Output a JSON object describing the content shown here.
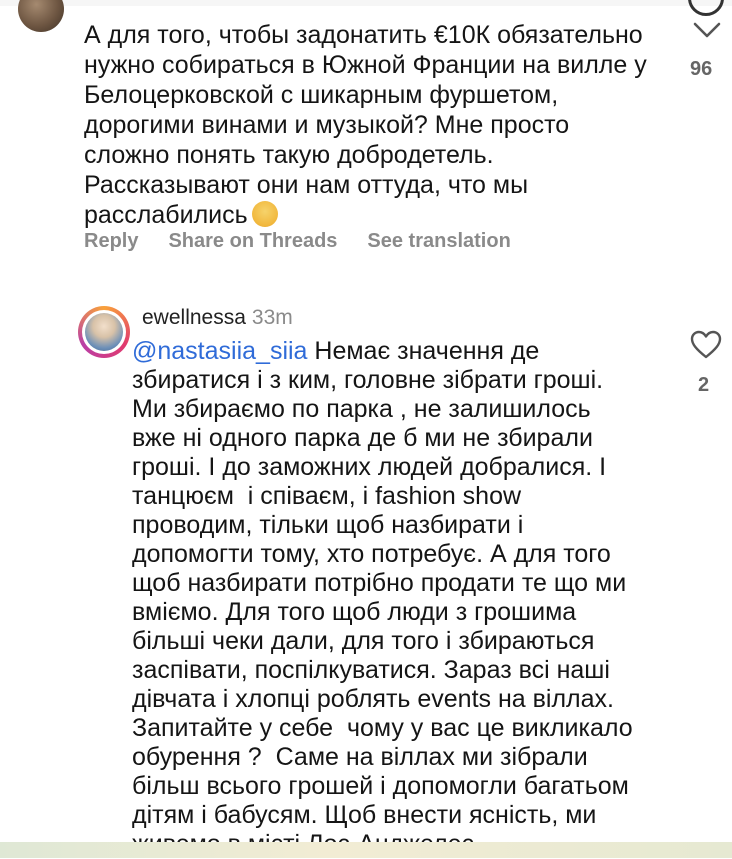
{
  "comment1": {
    "text_lines": [
      "А для того, чтобы задонатить €10К обязательно",
      "нужно собираться в Южной Франции на вилле у",
      "Белоцерковской с шикарным фуршетом,",
      "дорогими винами и музыкой? Мне просто",
      "сложно понять такую добродетель.",
      "Рассказывают они нам оттуда, что мы",
      "расслабились"
    ],
    "emoji_icon": "woman-facepalming-emoji",
    "likes": "96",
    "actions": [
      "Reply",
      "Share on Threads",
      "See translation"
    ]
  },
  "comment2": {
    "username": "ewellnessa",
    "time": "33m",
    "mention": "@nastasiia_siia",
    "first_line_rest": " Немає значення де",
    "text_lines": [
      "збиратися і з ким, головне зібрати гроші.",
      "Ми збираємо по парка , не залишилось",
      "вже ні одного парка де б ми не збирали",
      "гроші. І до заможних людей добралися. І",
      "танцюєм  і співаєм, і fashion show",
      "проводим, тільки щоб назбирати і",
      "допомогти тому, хто потребує. А для того",
      "щоб назбирати потрібно продати те що ми",
      "вміємо. Для того щоб люди з грошима",
      "більші чеки дали, для того і збираються",
      "заспівати, поспілкуватися. Зараз всі наші",
      "дівчата і хлопці роблять events на віллах.",
      "Запитайте у себе  чому у вас це викликало",
      "обурення ?  Саме на віллах ми зібрали",
      "більш всього грошей і допомогли багатьом",
      "дітям і бабусям. Щоб внести ясність, ми",
      "живемо в місті Лос-Анджелес."
    ],
    "likes": "2"
  },
  "colors": {
    "mention": "#2f6bd8",
    "secondary_text": "#8a8a8a"
  },
  "icons": {
    "comment1_like": "chevron-down-icon",
    "comment2_like": "heart-icon"
  }
}
